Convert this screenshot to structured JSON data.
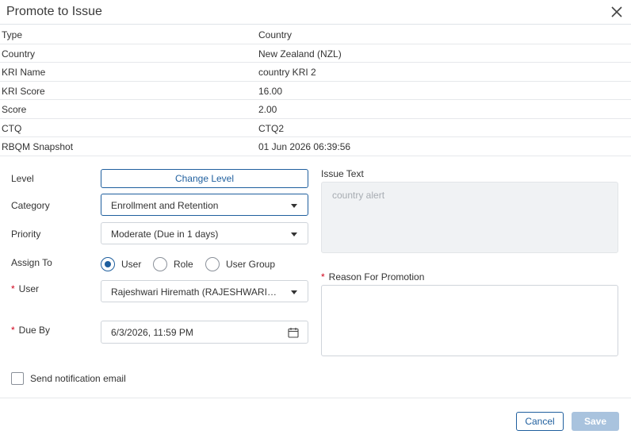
{
  "dialog": {
    "title": "Promote to Issue"
  },
  "info_rows": [
    {
      "key": "Type",
      "value": "Country"
    },
    {
      "key": "Country",
      "value": "New Zealand (NZL)"
    },
    {
      "key": "KRI Name",
      "value": "country KRI 2"
    },
    {
      "key": "KRI Score",
      "value": "16.00"
    },
    {
      "key": "Score",
      "value": "2.00"
    },
    {
      "key": "CTQ",
      "value": "CTQ2"
    },
    {
      "key": "RBQM Snapshot",
      "value": "01 Jun 2026 06:39:56"
    }
  ],
  "form": {
    "level": {
      "label": "Level",
      "button": "Change Level"
    },
    "category": {
      "label": "Category",
      "value": "Enrollment and Retention"
    },
    "priority": {
      "label": "Priority",
      "value": "Moderate (Due in 1 days)"
    },
    "assign_to": {
      "label": "Assign To",
      "options": [
        "User",
        "Role",
        "User Group"
      ],
      "selected": "User"
    },
    "user": {
      "required_mark": "*",
      "label": "User",
      "value": "Rajeshwari Hiremath (RAJESHWARI)..."
    },
    "due_by": {
      "required_mark": "*",
      "label": "Due By",
      "value": "6/3/2026, 11:59 PM"
    },
    "issue_text": {
      "label": "Issue Text",
      "placeholder": "country alert"
    },
    "reason": {
      "required_mark": "*",
      "label": "Reason For Promotion",
      "value": ""
    },
    "notify": {
      "label": "Send notification email",
      "checked": false
    }
  },
  "footer": {
    "cancel": "Cancel",
    "save": "Save"
  },
  "colors": {
    "accent": "#1f5f9e",
    "required": "#d0021b",
    "disabled_button": "#a9c3de"
  }
}
